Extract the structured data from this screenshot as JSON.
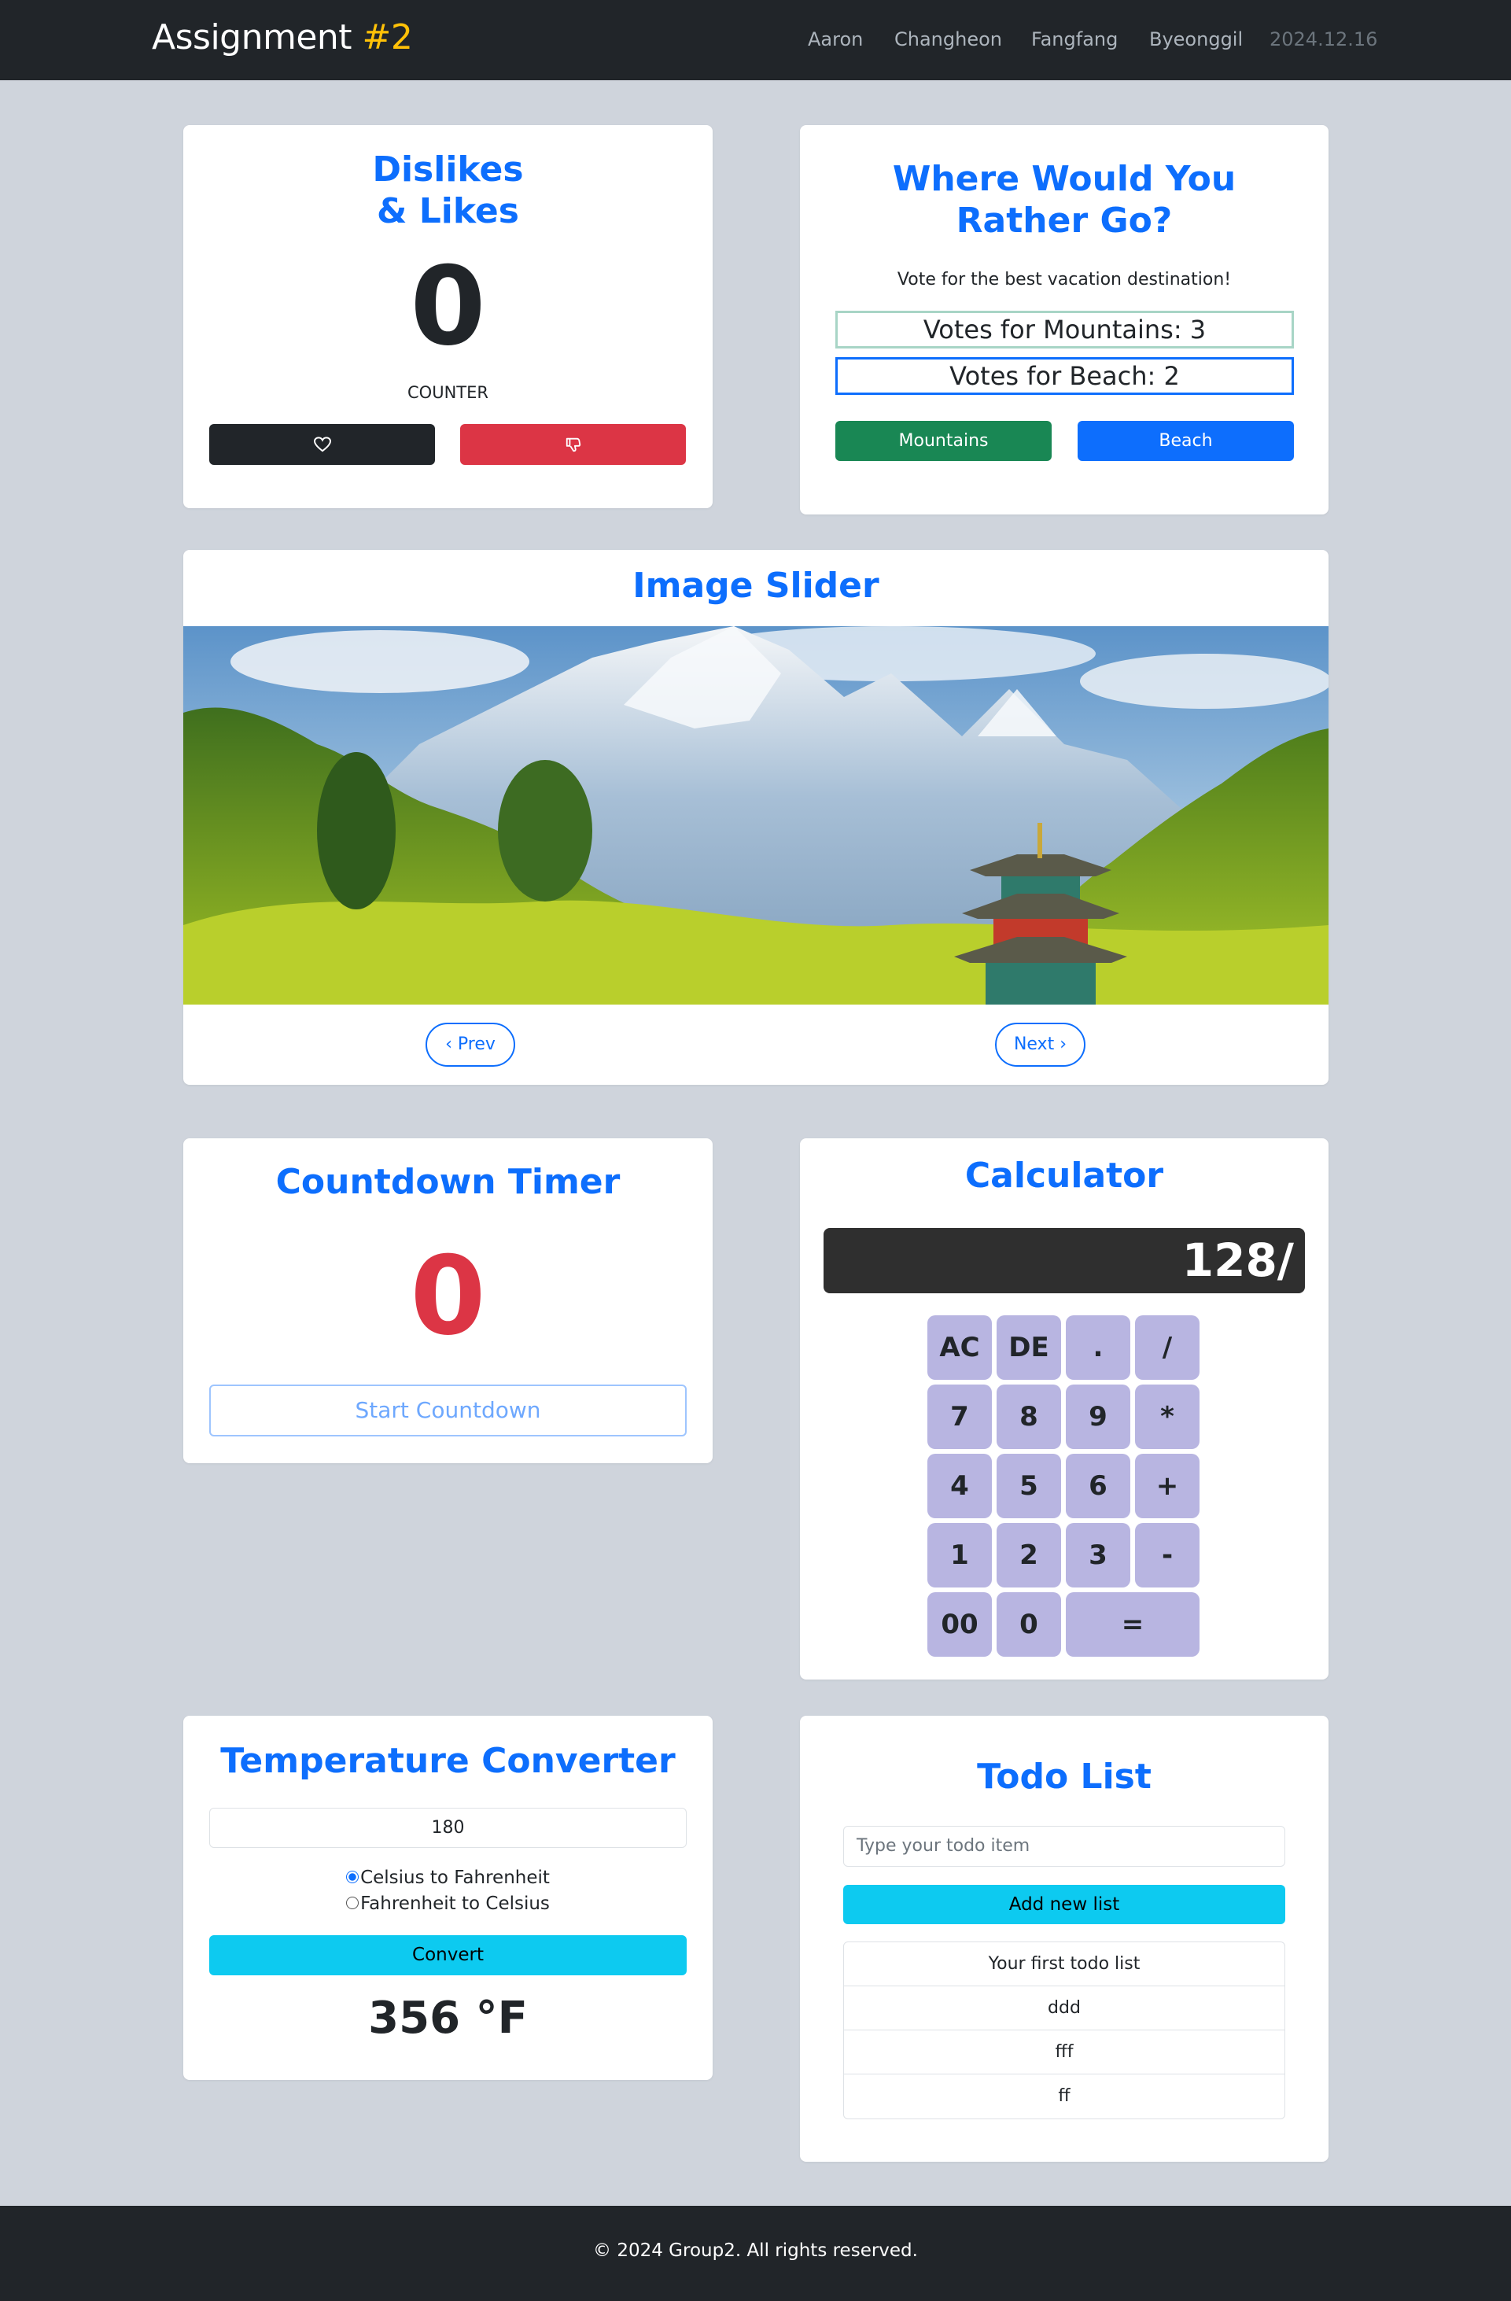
{
  "navbar": {
    "brand_text": "Assignment ",
    "brand_accent": "#2",
    "links": [
      "Aaron",
      "Changheon",
      "Fangfang",
      "Byeonggil"
    ],
    "date": "2024.12.16"
  },
  "likes": {
    "title_line1": "Dislikes",
    "title_line2": "& Likes",
    "counter": "0",
    "counter_label": "COUNTER",
    "like_icon": "heart-icon",
    "dislike_icon": "thumbs-down-icon"
  },
  "vote": {
    "title": "Where Would You Rather Go?",
    "description": "Vote for the best vacation destination!",
    "mountains_votes": "Votes for Mountains: 3",
    "beach_votes": "Votes for Beach: 2",
    "mountains_button": "Mountains",
    "beach_button": "Beach"
  },
  "slider": {
    "title": "Image Slider",
    "prev_label": "Prev",
    "next_label": "Next"
  },
  "countdown": {
    "title": "Countdown Timer",
    "value": "0",
    "button_label": "Start Countdown"
  },
  "calculator": {
    "title": "Calculator",
    "display": "128/",
    "keys": [
      "AC",
      "DE",
      ".",
      "/",
      "7",
      "8",
      "9",
      "*",
      "4",
      "5",
      "6",
      "+",
      "1",
      "2",
      "3",
      "-",
      "00",
      "0",
      "="
    ]
  },
  "temperature": {
    "title": "Temperature Converter",
    "input_value": "180",
    "option_c_to_f": "Celsius to Fahrenheit",
    "option_f_to_c": "Fahrenheit to Celsius",
    "selected_option": "Celsius to Fahrenheit",
    "convert_button": "Convert",
    "result": "356 °F"
  },
  "todo": {
    "title": "Todo List",
    "input_placeholder": "Type your todo item",
    "add_button": "Add new list",
    "items": [
      "Your first todo list",
      "ddd",
      "fff",
      "ff"
    ]
  },
  "footer": {
    "text": "© 2024 Group2. All rights reserved."
  },
  "colors": {
    "primary": "#0d6efd",
    "danger": "#dc3545",
    "success": "#198754",
    "info": "#0dcaf0",
    "dark": "#212529",
    "accent": "#ffc107",
    "calc_key": "#b8b5e1"
  }
}
